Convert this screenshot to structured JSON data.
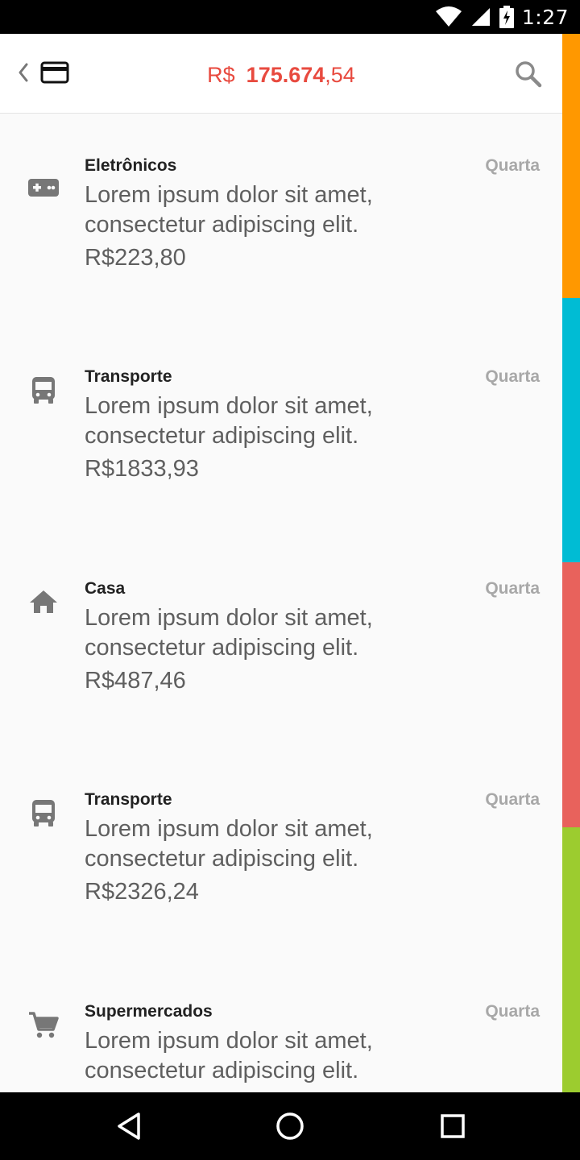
{
  "status_bar": {
    "time": "1:27"
  },
  "toolbar": {
    "back_icon": "chevron-left-icon",
    "card_icon": "credit-card-icon",
    "balance_currency": "R$",
    "balance_integer": "175.674",
    "balance_decimal": ",54",
    "search_icon": "search-icon"
  },
  "colors": {
    "accent": "#e84a3f",
    "strip": [
      "#ff9800",
      "#00bcd4",
      "#e8625c",
      "#9ccc2f"
    ]
  },
  "transactions": [
    {
      "icon": "gamepad-icon",
      "category": "Eletrônicos",
      "day": "Quarta",
      "desc_line1": "Lorem ipsum dolor sit amet,",
      "desc_line2": "consectetur adipiscing elit.",
      "amount": "R$223,80"
    },
    {
      "icon": "bus-icon",
      "category": "Transporte",
      "day": "Quarta",
      "desc_line1": "Lorem ipsum dolor sit amet,",
      "desc_line2": "consectetur adipiscing elit.",
      "amount": "R$1833,93"
    },
    {
      "icon": "home-icon",
      "category": "Casa",
      "day": "Quarta",
      "desc_line1": "Lorem ipsum dolor sit amet,",
      "desc_line2": "consectetur adipiscing elit.",
      "amount": "R$487,46"
    },
    {
      "icon": "bus-icon",
      "category": "Transporte",
      "day": "Quarta",
      "desc_line1": "Lorem ipsum dolor sit amet,",
      "desc_line2": "consectetur adipiscing elit.",
      "amount": "R$2326,24"
    },
    {
      "icon": "shopping-cart-icon",
      "category": "Supermercados",
      "day": "Quarta",
      "desc_line1": "Lorem ipsum dolor sit amet,",
      "desc_line2": "consectetur adipiscing elit.",
      "amount": ""
    }
  ],
  "nav_bar": {
    "back_icon": "nav-back-icon",
    "home_icon": "nav-home-icon",
    "recents_icon": "nav-recents-icon"
  }
}
